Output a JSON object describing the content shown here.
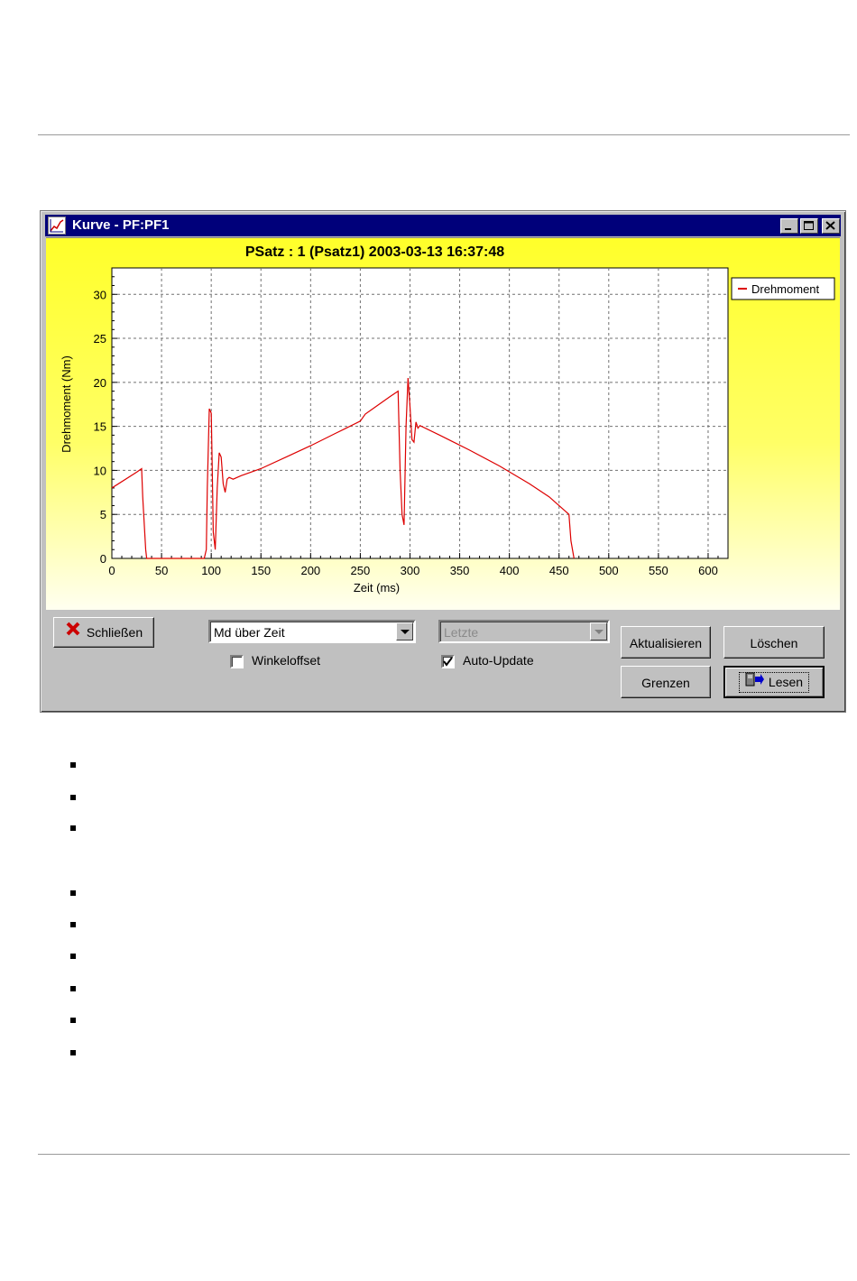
{
  "window": {
    "title": "Kurve - PF:PF1",
    "controls": {
      "minimize": "_",
      "maximize": "□",
      "close": "×"
    }
  },
  "chart_data": {
    "type": "line",
    "title": "PSatz : 1 (Psatz1)  2003-03-13  16:37:48",
    "xlabel": "Zeit (ms)",
    "ylabel": "Drehmoment (Nm)",
    "xlim": [
      0,
      620
    ],
    "ylim": [
      0,
      33
    ],
    "x_ticks": [
      0,
      50,
      100,
      150,
      200,
      250,
      300,
      350,
      400,
      450,
      500,
      550,
      600
    ],
    "y_ticks": [
      0,
      5,
      10,
      15,
      20,
      25,
      30
    ],
    "grid": true,
    "legend_position": "top-right",
    "series": [
      {
        "name": "Drehmoment",
        "color": "#dd0000",
        "x": [
          0,
          25,
          30,
          31,
          34,
          35,
          93,
          95,
          96,
          98,
          100,
          101,
          102,
          104,
          106,
          108,
          110,
          112,
          114,
          116,
          118,
          122,
          130,
          150,
          175,
          200,
          225,
          250,
          255,
          265,
          280,
          288,
          290,
          292,
          294,
          296,
          298,
          300,
          302,
          304,
          306,
          308,
          310,
          330,
          360,
          390,
          420,
          440,
          455,
          460,
          462,
          465
        ],
        "y": [
          8,
          9.8,
          10.2,
          7,
          1,
          0,
          0,
          1,
          8,
          17,
          16.5,
          10,
          3,
          1,
          8,
          12,
          11.5,
          8.5,
          7.5,
          9,
          9.2,
          9,
          9.4,
          10.2,
          11.5,
          12.8,
          14.2,
          15.6,
          16.4,
          17.2,
          18.4,
          19,
          10,
          5,
          3.8,
          15,
          20.5,
          17.2,
          13.5,
          13.2,
          15.5,
          14.8,
          15.1,
          14,
          12.3,
          10.5,
          8.5,
          7,
          5.5,
          5,
          2,
          0
        ]
      }
    ]
  },
  "controls": {
    "close_button": "Schließen",
    "view_select": "Md über Zeit",
    "winkel_checkbox_label": "Winkeloffset",
    "winkel_checked": false,
    "letzte_select": "Letzte",
    "autoupdate_checkbox_label": "Auto-Update",
    "autoupdate_checked": true,
    "aktualisieren_button": "Aktualisieren",
    "loeschen_button": "Löschen",
    "grenzen_button": "Grenzen",
    "lesen_button": "Lesen"
  }
}
